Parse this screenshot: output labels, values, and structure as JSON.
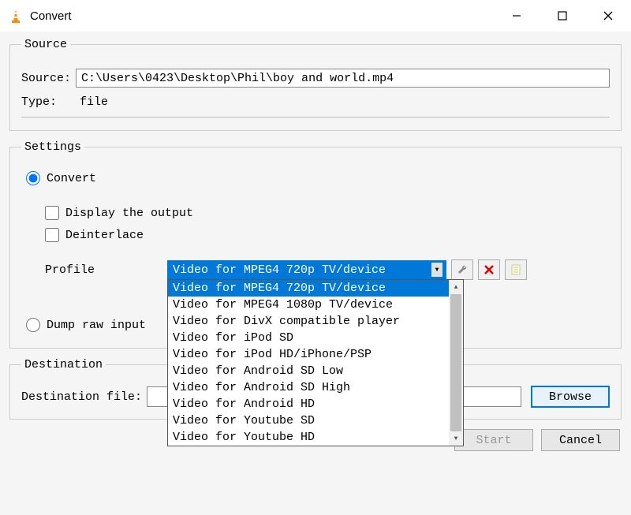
{
  "window": {
    "title": "Convert"
  },
  "source": {
    "legend": "Source",
    "source_label": "Source:",
    "source_value": "C:\\Users\\0423\\Desktop\\Phil\\boy and world.mp4",
    "type_label": "Type:",
    "type_value": "file"
  },
  "settings": {
    "legend": "Settings",
    "convert_label": "Convert",
    "display_output_label": "Display the output",
    "deinterlace_label": "Deinterlace",
    "profile_label": "Profile",
    "profile_selected": "Video for MPEG4 720p TV/device",
    "profile_options": [
      "Video for MPEG4 720p TV/device",
      "Video for MPEG4 1080p TV/device",
      "Video for DivX compatible player",
      "Video for iPod SD",
      "Video for iPod HD/iPhone/PSP",
      "Video for Android SD Low",
      "Video for Android SD High",
      "Video for Android HD",
      "Video for Youtube SD",
      "Video for Youtube HD"
    ],
    "dump_label": "Dump raw input"
  },
  "destination": {
    "legend": "Destination",
    "file_label": "Destination file:",
    "browse_label": "Browse"
  },
  "buttons": {
    "start": "Start",
    "cancel": "Cancel"
  }
}
